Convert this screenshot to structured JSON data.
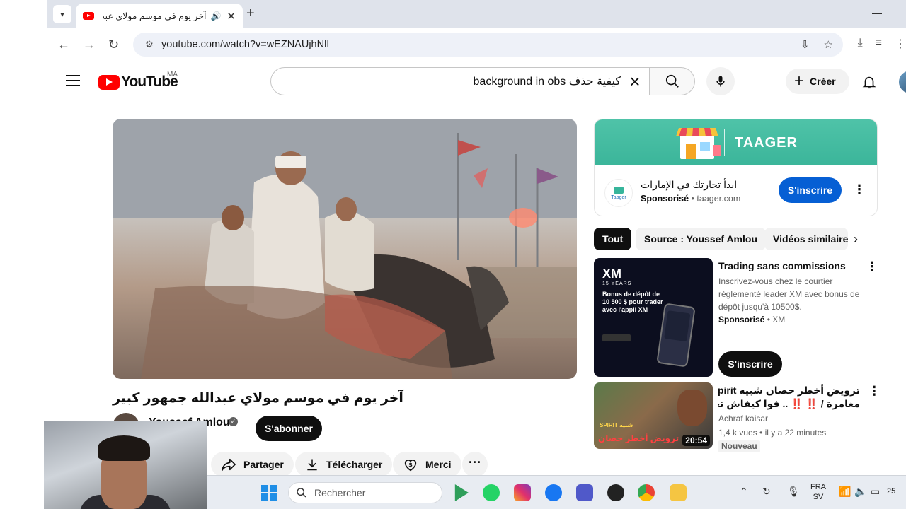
{
  "browser": {
    "tab_title": "آخر يوم في موسم مولاي عبدالله",
    "url": "youtube.com/watch?v=wEZNAUjhNlI"
  },
  "youtube": {
    "logo_text": "YouTube",
    "country": "MA",
    "search_query": "كيفية حذف background in obs",
    "create_label": "Créer"
  },
  "video": {
    "title": "آخر يوم في موسم مولاي عبدالله جمهور كبير",
    "channel": "Youssef Amlou",
    "subscribe_label": "S'abonner",
    "actions": {
      "share": "Partager",
      "download": "Télécharger",
      "thanks": "Merci"
    }
  },
  "sidebar_ad": {
    "brand": "TAAGER",
    "logo_text": "Taager",
    "title": "ابدأ تجارتك في الإمارات",
    "sponsored": "Sponsorisé",
    "domain": "taager.com",
    "subscribe_label": "S'inscrire"
  },
  "chips": [
    "Tout",
    "Source : Youssef Amlou",
    "Vidéos similaires"
  ],
  "recommendations": [
    {
      "title": "Trading sans commissions",
      "description": "Inscrivez-vous chez le courtier réglementé leader XM avec bonus de dépôt jusqu'à 10500$.",
      "sponsored": "Sponsorisé",
      "advertiser": "XM",
      "cta": "S'inscrire",
      "thumb": {
        "logo": "XM",
        "years": "15 YEARS",
        "text": "Bonus de dépôt de 10 500 $ pour trader avec l'appli XM"
      }
    },
    {
      "title_line1": "ترويض أخطر حصان شبيه spirit 😱",
      "title_line2": "مغامرة / ‼️ ‼️ .. فوا كيفاش تعاملنا معاه",
      "channel": "Achraf kaisar",
      "views": "1,4 k vues",
      "age": "il y a 22 minutes",
      "badge": "Nouveau",
      "duration": "20:54",
      "thumb_label": "ترويض أخطر حصان",
      "thumb_label2": "SPIRIT شبيه"
    }
  ],
  "taskbar": {
    "search_placeholder": "Rechercher",
    "lang_top": "FRA",
    "lang_bottom": "SV",
    "clock_partial": "25"
  },
  "colors": {
    "youtube_red": "#ff0000",
    "subscribe_blue": "#065fd4",
    "taager_green": "#3bb59a"
  }
}
